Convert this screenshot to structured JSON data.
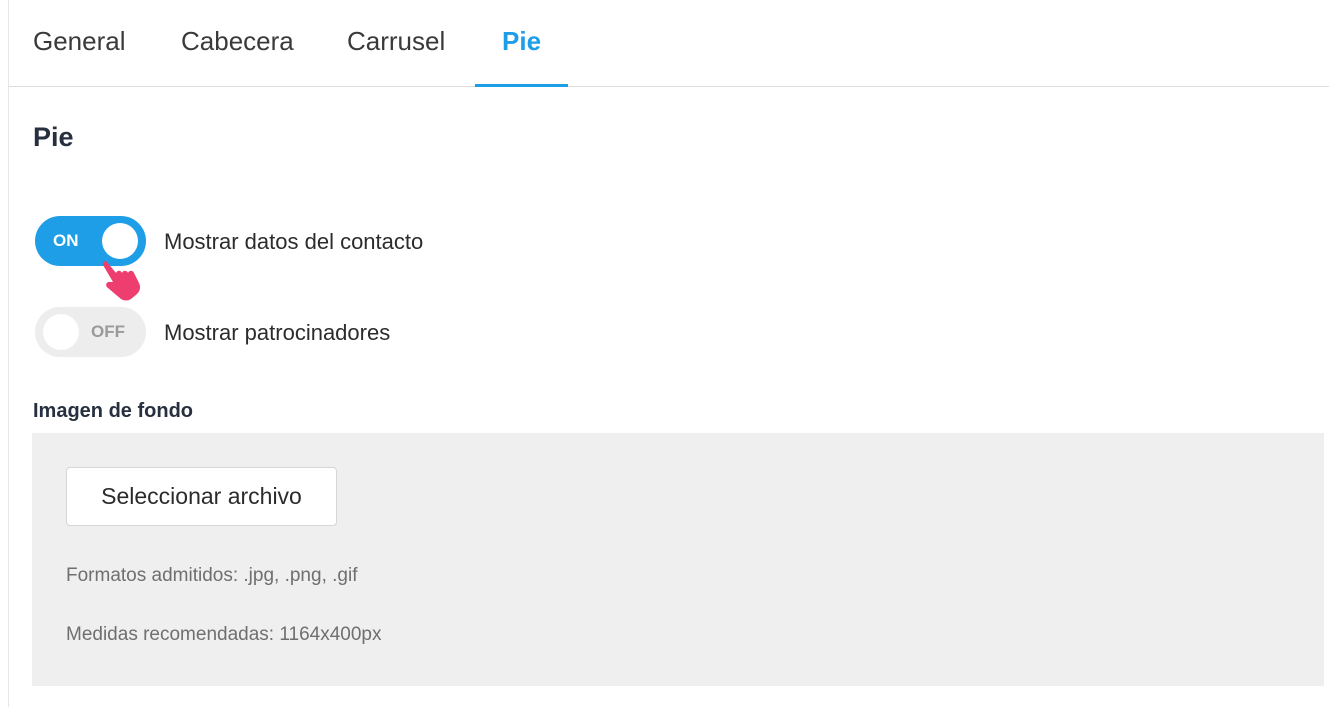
{
  "tabs": [
    {
      "label": "General",
      "active": false
    },
    {
      "label": "Cabecera",
      "active": false
    },
    {
      "label": "Carrusel",
      "active": false
    },
    {
      "label": "Pie",
      "active": true
    }
  ],
  "section": {
    "title": "Pie"
  },
  "toggles": [
    {
      "state": "ON",
      "checked": true,
      "label": "Mostrar datos del contacto"
    },
    {
      "state": "OFF",
      "checked": false,
      "label": "Mostrar patrocinadores"
    }
  ],
  "background_image": {
    "label": "Imagen de fondo",
    "button_label": "Seleccionar archivo",
    "formats_text": "Formatos admitidos: .jpg, .png, .gif",
    "size_text": "Medidas recomendadas: 1164x400px"
  },
  "colors": {
    "accent": "#1e9ee6",
    "toggle_off": "#ededed",
    "panel_bg": "#efefef",
    "pointer": "#ee3d6f"
  },
  "icons": {
    "pointer": "hand-pointer-icon"
  }
}
